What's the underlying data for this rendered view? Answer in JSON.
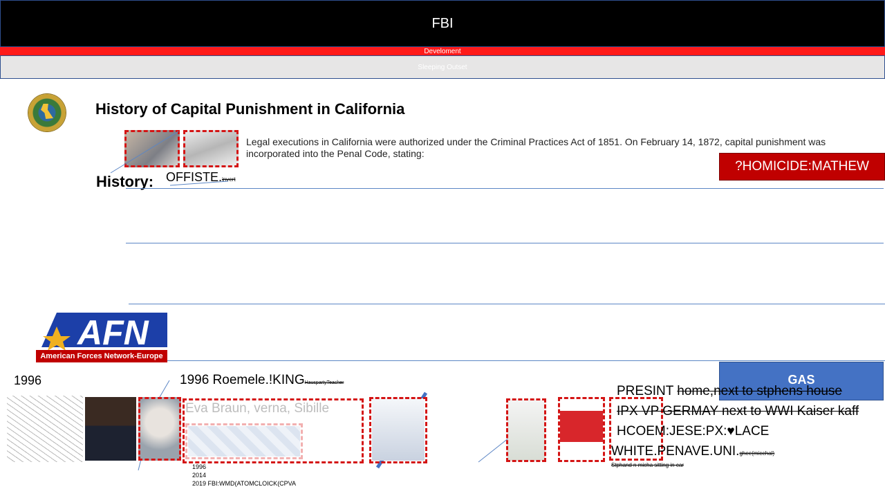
{
  "header": {
    "title": "FBI",
    "red_band": "Develoment",
    "gray_band": "Sleeping Outset"
  },
  "main": {
    "title": "History of Capital Punishment in California",
    "intro": "Legal executions in California were authorized under the Criminal Practices Act of 1851. On February 14, 1872, capital punishment was incorporated into the Penal Code, stating:",
    "history_label": "History:",
    "offiste": "OFFISTE.",
    "offiste_small": "invert",
    "homicide_button": "?HOMICIDE:MATHEW",
    "gas_button": "GAS"
  },
  "afn": {
    "letters": "AFN",
    "tagline": "American Forces Network-Europe"
  },
  "lower": {
    "year_left": "1996",
    "roemele": "1996 Roemele.!KING",
    "roemele_small": "HauspartyTeacher",
    "eva": "Eva Braun, verna, Sibille",
    "years_list": [
      "1996",
      "2014",
      "2019 FBI:WMD(ATOMCLOICK(CPVA"
    ]
  },
  "notes": {
    "line1_a": "PRESINT ",
    "line1_b": "home,next to stphens house",
    "line2": "IPX VP GERMAY next to WWI Kaiser kaff",
    "line3": "HCOEM:JESE:PX:♥LACE",
    "line4": "WHITE.PENAVE.UNI.",
    "line4_small": "ghee(micehal)",
    "line5": "Stphand n micha sitting in car"
  },
  "colors": {
    "accent_red": "#c00000",
    "accent_blue": "#4472c4",
    "dash_red": "#d41414"
  }
}
